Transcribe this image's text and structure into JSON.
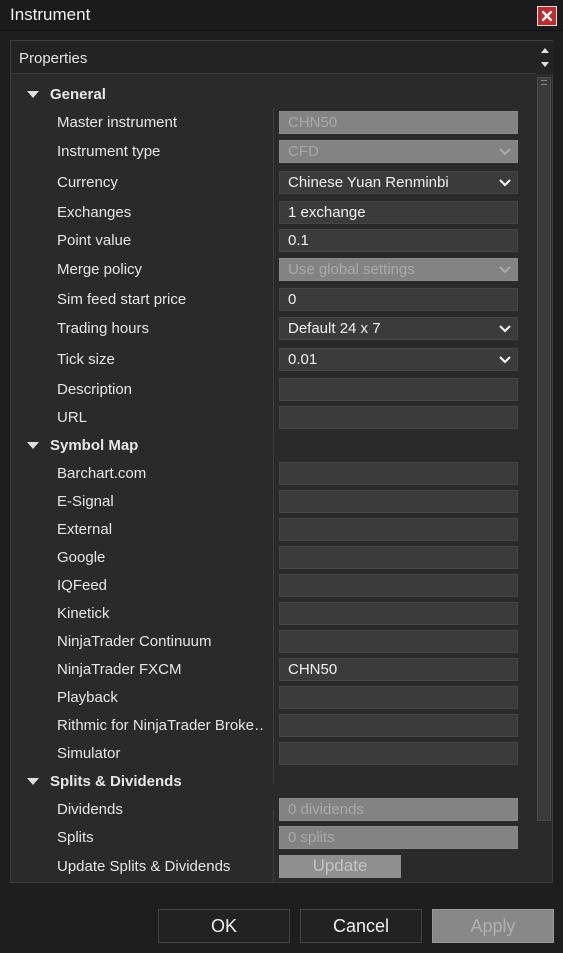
{
  "window": {
    "title": "Instrument"
  },
  "panel": {
    "title": "Properties"
  },
  "categories": {
    "general": "General",
    "symbol_map": "Symbol Map",
    "splits": "Splits & Dividends"
  },
  "general": {
    "master_instrument": {
      "label": "Master instrument",
      "value": "CHN50"
    },
    "instrument_type": {
      "label": "Instrument type",
      "value": "CFD"
    },
    "currency": {
      "label": "Currency",
      "value": "Chinese Yuan Renminbi"
    },
    "exchanges": {
      "label": "Exchanges",
      "value": "1 exchange"
    },
    "point_value": {
      "label": "Point value",
      "value": "0.1"
    },
    "merge_policy": {
      "label": "Merge policy",
      "value": "Use global settings"
    },
    "sim_feed_start_price": {
      "label": "Sim feed start price",
      "value": "0"
    },
    "trading_hours": {
      "label": "Trading hours",
      "value": "Default 24 x 7"
    },
    "tick_size": {
      "label": "Tick size",
      "value": "0.01"
    },
    "description": {
      "label": "Description",
      "value": ""
    },
    "url": {
      "label": "URL",
      "value": ""
    }
  },
  "symbol_map": {
    "barchart": {
      "label": "Barchart.com",
      "value": ""
    },
    "esignal": {
      "label": "E-Signal",
      "value": ""
    },
    "external": {
      "label": "External",
      "value": ""
    },
    "google": {
      "label": "Google",
      "value": ""
    },
    "iqfeed": {
      "label": "IQFeed",
      "value": ""
    },
    "kinetick": {
      "label": "Kinetick",
      "value": ""
    },
    "nt_continuum": {
      "label": "NinjaTrader Continuum",
      "value": ""
    },
    "nt_fxcm": {
      "label": "NinjaTrader FXCM",
      "value": "CHN50"
    },
    "playback": {
      "label": "Playback",
      "value": ""
    },
    "rithmic": {
      "label": "Rithmic for NinjaTrader Broke…",
      "value": ""
    },
    "simulator": {
      "label": "Simulator",
      "value": ""
    }
  },
  "splits": {
    "dividends": {
      "label": "Dividends",
      "value": "0 dividends"
    },
    "splits": {
      "label": "Splits",
      "value": "0 splits"
    },
    "update": {
      "label": "Update Splits & Dividends",
      "button": "Update"
    }
  },
  "buttons": {
    "ok": "OK",
    "cancel": "Cancel",
    "apply": "Apply"
  },
  "icons": {
    "close": "close-icon",
    "collapse": "triangle-down-icon",
    "dropdown": "chevron-down-icon",
    "scroll_up": "arrow-up-icon",
    "scroll_down": "arrow-down-icon"
  },
  "colors": {
    "background": "#1e1e1e",
    "panel": "#2a2a2a",
    "field": "#3b3b3b",
    "field_disabled": "#838383",
    "close_button": "#c42a2a"
  }
}
